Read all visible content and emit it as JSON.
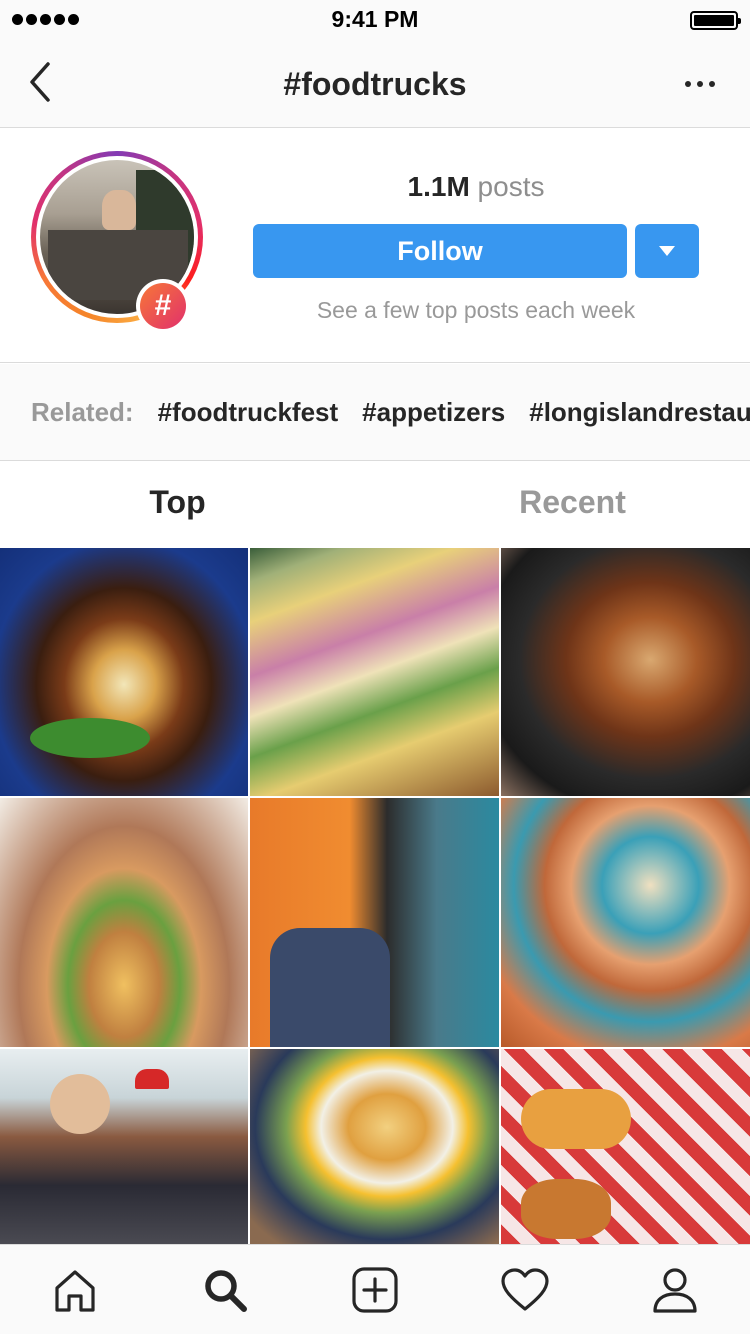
{
  "status_bar": {
    "time": "9:41 PM",
    "signal_bars": 5,
    "battery_level": 1.0
  },
  "nav": {
    "title": "#foodtrucks",
    "back_icon": "chevron-left-icon",
    "more_icon": "more-horizontal-icon"
  },
  "header": {
    "post_count": "1.1M",
    "post_label": "posts",
    "follow_label": "Follow",
    "dropdown_icon": "caret-down-icon",
    "caption": "See a few top posts each week",
    "badge_symbol": "#"
  },
  "related": {
    "label": "Related:",
    "tags": [
      "#foodtruckfest",
      "#appetizers",
      "#longislandrestaurants"
    ]
  },
  "tabs": {
    "top": "Top",
    "recent": "Recent",
    "active": "Top"
  },
  "grid": {
    "tiles": [
      "burger-photo",
      "tacos-photo",
      "chicken-sandwich-photo",
      "person-eating-burger-photo",
      "food-truck-couple-photo",
      "tacos-plates-photo",
      "friends-eating-photo",
      "egg-burger-photo",
      "hotdogs-onion-rings-photo"
    ]
  },
  "tab_bar": {
    "items": [
      "home-icon",
      "search-icon",
      "new-post-icon",
      "activity-heart-icon",
      "profile-icon"
    ],
    "active": "search-icon"
  },
  "colors": {
    "accent": "#3897f0",
    "text": "#262626",
    "muted": "#999999",
    "divider": "#dbdbdb"
  }
}
